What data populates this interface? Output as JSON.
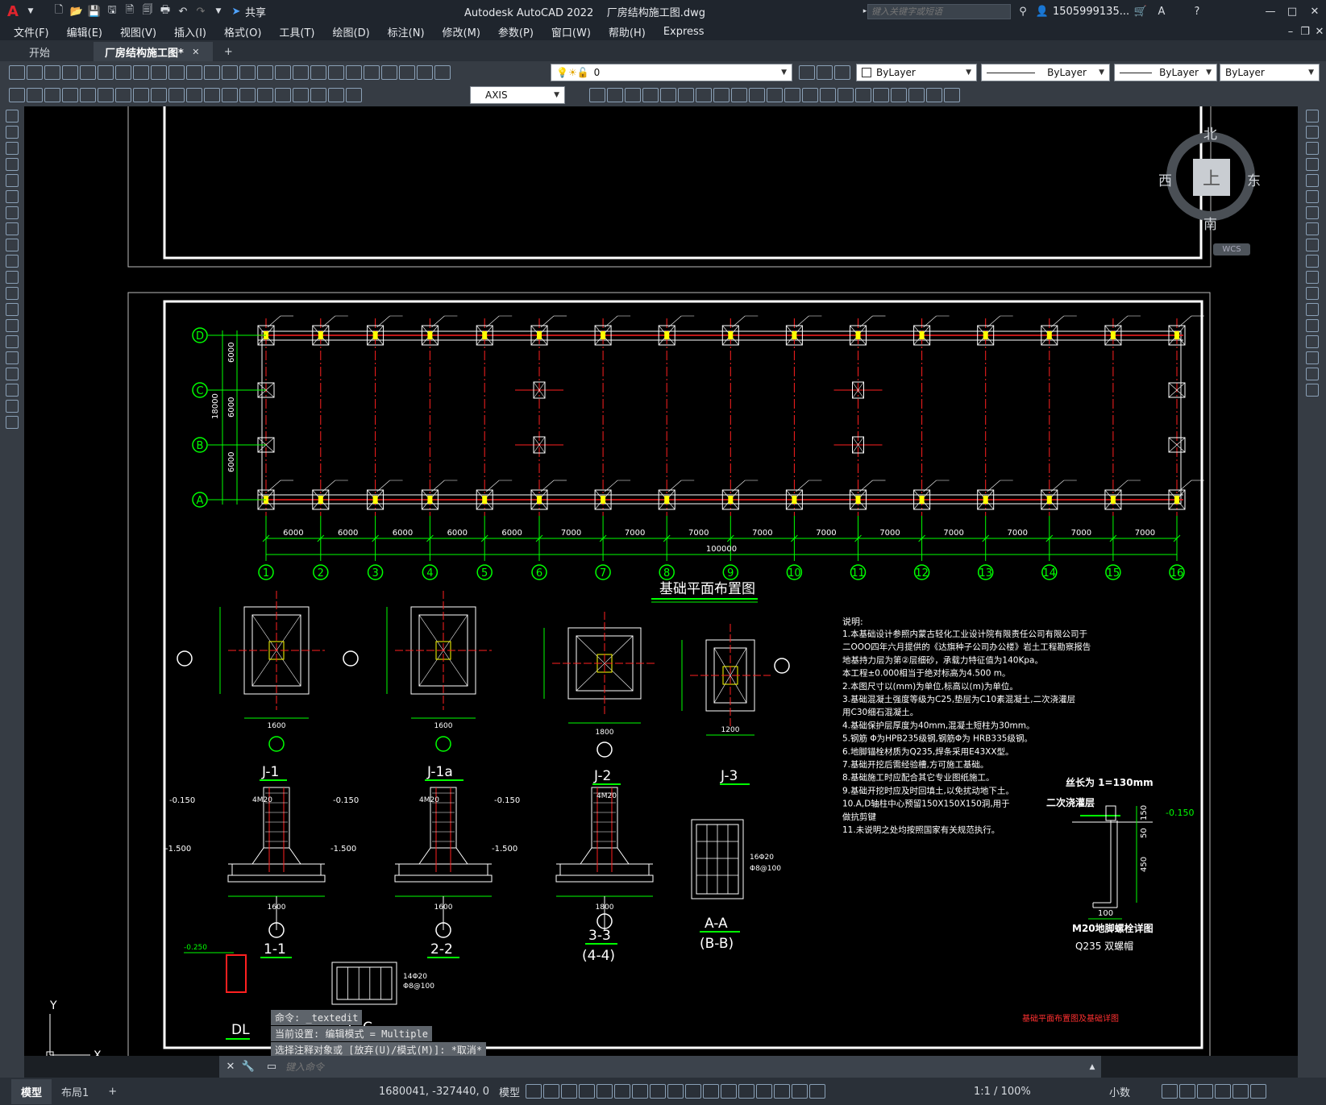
{
  "app": {
    "title": "Autodesk AutoCAD 2022",
    "filename": "厂房结构施工图.dwg",
    "share_label": "共享",
    "search_placeholder": "键入关键字或短语",
    "user": "1505999135..."
  },
  "menu": [
    "文件(F)",
    "编辑(E)",
    "视图(V)",
    "插入(I)",
    "格式(O)",
    "工具(T)",
    "绘图(D)",
    "标注(N)",
    "修改(M)",
    "参数(P)",
    "窗口(W)",
    "帮助(H)",
    "Express"
  ],
  "tabs": {
    "start": "开始",
    "drawing": "厂房结构施工图*",
    "add": "+"
  },
  "toolbar": {
    "layer_value": "0",
    "color": "ByLayer",
    "linetype": "ByLayer",
    "lineweight": "ByLayer",
    "plotstyle": "ByLayer",
    "dimstyle": "AXIS"
  },
  "viewcube": {
    "north": "北",
    "south": "南",
    "east": "东",
    "west": "西",
    "top": "上",
    "wcs": "WCS"
  },
  "drawing": {
    "plan_title": "基础平面布置图",
    "total_length": "100000",
    "total_height": "18000",
    "span_6000": "6000",
    "span_7000": "7000",
    "axes_letters": [
      "D",
      "C",
      "B",
      "A"
    ],
    "axes_numbers": [
      "1",
      "2",
      "3",
      "4",
      "5",
      "6",
      "7",
      "8",
      "9",
      "10",
      "11",
      "12",
      "13",
      "14",
      "15",
      "16"
    ],
    "x_spans": [
      "6000",
      "6000",
      "6000",
      "6000",
      "6000",
      "7000",
      "7000",
      "7000",
      "7000",
      "7000",
      "7000",
      "7000",
      "7000",
      "7000",
      "7000"
    ],
    "footing_labels": [
      "J-1",
      "J-1a",
      "J-2",
      "J-3"
    ],
    "section_labels": [
      "1-1",
      "2-2",
      "3-3",
      "(4-4)",
      "A-A",
      "(B-B)",
      "DL",
      "C-C"
    ],
    "label_j1": "J-1",
    "label_j1a": "J-1a",
    "label_j2": "J-2",
    "label_j3": "J-3",
    "label_11": "1-1",
    "label_22": "2-2",
    "label_33": "3-3",
    "label_44": "(4-4)",
    "label_aa": "A-A",
    "label_bb": "(B-B)",
    "label_dl": "DL",
    "label_cc": "C-C",
    "dim_1600": "1600",
    "dim_1800": "1800",
    "dim_1200": "1200",
    "elev_minus_150": "-0.150",
    "elev_minus_1500": "-1.500",
    "rebar_4m20": "4M20",
    "rebar_16_20": "16Φ20",
    "rebar_8_100": "Φ8@100",
    "rebar_14_20": "14Φ20",
    "secondary_grout": "二次浇灌层",
    "thread_length": "丝长为 1=130mm",
    "bolt_title": "M20地脚螺栓详图",
    "bolt_sub": "Q235  双螺帽",
    "bolt_dim_100": "100",
    "bolt_dim_450": "450",
    "bolt_dim_50": "50",
    "bolt_dim_150": "150",
    "sheet_title": "基础平面布置图及基础详图",
    "notes_title": "说明:",
    "notes": [
      "1.本基础设计参照内蒙古轻化工业设计院有限责任公司有限公司于",
      "  二OOO四年六月提供的《达旗种子公司办公楼》岩土工程勘察报告",
      "  地基持力层为第②层细砂，承载力特征值为140Kpa。",
      "  本工程±0.000相当于绝对标高为4.500 m。",
      "2.本图尺寸以(mm)为单位,标高以(m)为单位。",
      "3.基础混凝土强度等级为C25,垫层为C10素混凝土,二次浇灌层",
      "  用C30细石混凝土。",
      "4.基础保护层厚度为40mm,混凝土短柱为30mm。",
      "5.钢筋 Φ为HPB235级钢,钢筋Φ为 HRB335级钢。",
      "6.地脚锚栓材质为Q235,焊条采用E43XX型。",
      "7.基础开挖后需经验槽,方可施工基础。",
      "8.基础施工时应配合其它专业图纸施工。",
      "9.基础开挖时应及时回填土,以免扰动地下土。",
      "10.A,D轴柱中心预留150X150X150洞,用于",
      "   做抗剪键",
      "11.未说明之处均按照国家有关规范执行。"
    ]
  },
  "command": {
    "history1": "命令: _textedit",
    "history2": "当前设置: 编辑模式 = Multiple",
    "history3": "选择注释对象或 [放弃(U)/模式(M)]: *取消*",
    "placeholder": "键入命令"
  },
  "status": {
    "coords": "1680041, -327440, 0",
    "model": "模型",
    "scale": "1:1 / 100%",
    "units": "小数"
  },
  "layout_tabs": {
    "model": "模型",
    "layout1": "布局1",
    "add": "+"
  },
  "colors": {
    "green": "#00ff00",
    "red": "#ff2020",
    "yellow": "#ffff00",
    "white": "#ffffff",
    "cyan": "#00ffff"
  }
}
